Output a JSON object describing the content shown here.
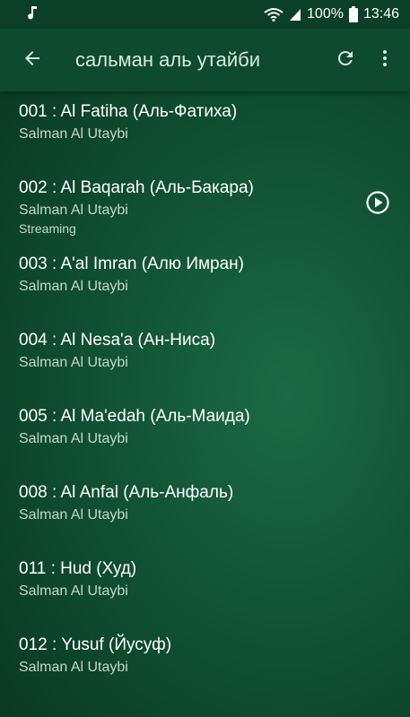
{
  "status_bar": {
    "battery": "100%",
    "time": "13:46",
    "icons": [
      "music-note-icon",
      "wifi-icon",
      "signal-icon",
      "battery-icon"
    ]
  },
  "toolbar": {
    "title": "сальман аль утайби",
    "icons": [
      "back-arrow-icon",
      "refresh-icon",
      "more-vert-icon"
    ]
  },
  "tracks": [
    {
      "title": "001 : Al Fatiha (Аль-Фатиха)",
      "artist": "Salman Al Utaybi",
      "status": ""
    },
    {
      "title": "002 : Al Baqarah (Аль-Бакара)",
      "artist": "Salman Al Utaybi",
      "status": "Streaming"
    },
    {
      "title": "003 : A'al Imran (Алю Имран)",
      "artist": "Salman Al Utaybi",
      "status": ""
    },
    {
      "title": "004 : Al Nesa'a (Ан-Ниса)",
      "artist": "Salman Al Utaybi",
      "status": ""
    },
    {
      "title": "005 : Al Ma'edah (Аль-Маида)",
      "artist": "Salman Al Utaybi",
      "status": ""
    },
    {
      "title": "008 : Al Anfal (Аль-Анфаль)",
      "artist": "Salman Al Utaybi",
      "status": ""
    },
    {
      "title": "011 : Hud (Худ)",
      "artist": "Salman Al Utaybi",
      "status": ""
    },
    {
      "title": "012 : Yusuf (Йусуф)",
      "artist": "Salman Al Utaybi",
      "status": ""
    }
  ],
  "colors": {
    "toolbar": "#0d4a2f",
    "status_bar": "#0b3f28",
    "background": "#0f4d30",
    "text_primary": "#ffffff",
    "text_secondary": "#c6d6cc"
  }
}
